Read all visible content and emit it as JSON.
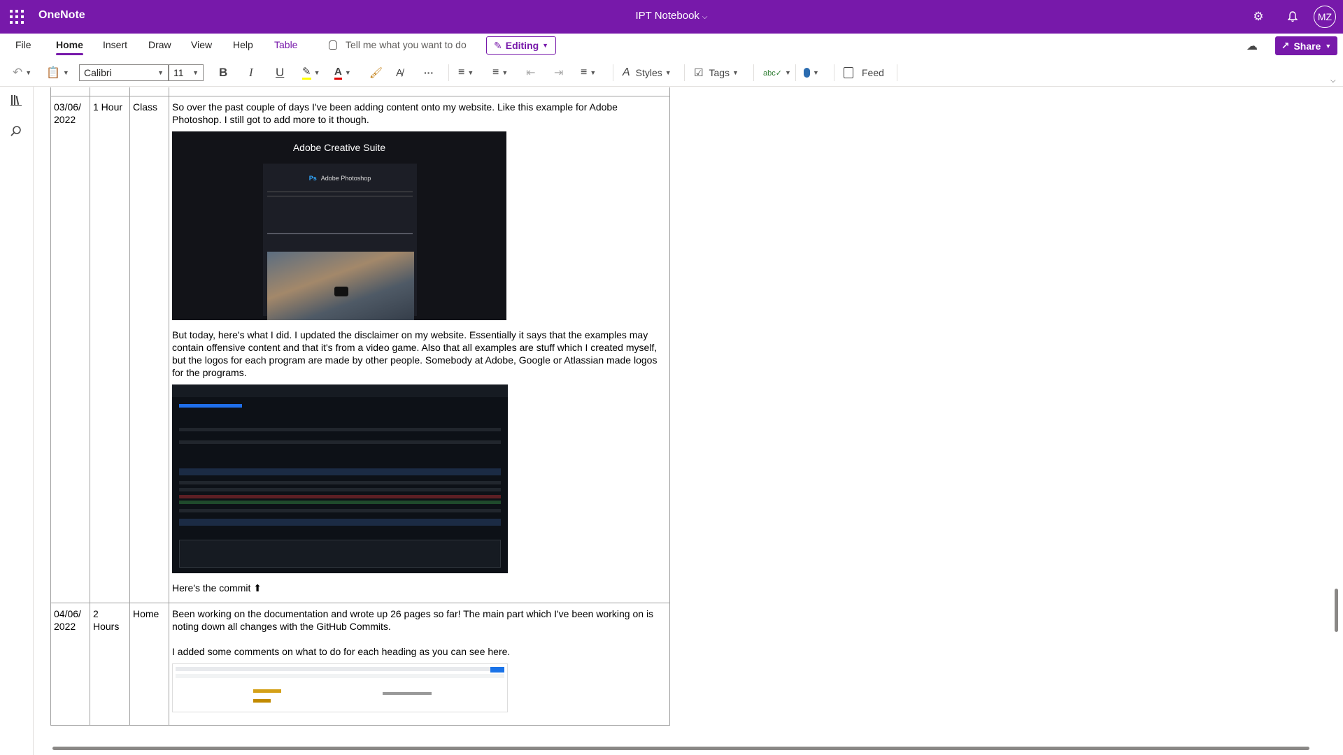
{
  "app": {
    "name": "OneNote",
    "notebook": "IPT Notebook",
    "user_initials": "MZ",
    "accent_color": "#7719aa"
  },
  "menu": {
    "tabs": [
      "File",
      "Home",
      "Insert",
      "Draw",
      "View",
      "Help",
      "Table"
    ],
    "active_tab": "Home",
    "tell_me_placeholder": "Tell me what you want to do",
    "mode_label": "Editing",
    "share_label": "Share"
  },
  "toolbar": {
    "font_name": "Calibri",
    "font_size": "11",
    "bold": "B",
    "italic": "I",
    "underline": "U",
    "more": "···",
    "styles_label": "Styles",
    "tags_label": "Tags",
    "feed_label": "Feed",
    "highlight_color": "#ffff00",
    "font_color": "#e00000"
  },
  "rows": [
    {
      "date": "03/06/ 2022",
      "duration": "1 Hour",
      "location": "Class",
      "text1": "So over the past couple of days I've been adding content onto my website. Like this example for Adobe Photoshop. I still got to add more to it though.",
      "image1": {
        "title": "Adobe Creative Suite",
        "badge": "Ps",
        "subtitle": "Adobe Photoshop"
      },
      "text2": "But today, here's what I did. I updated the disclaimer on my website. Essentially it says that the examples may contain offensive content and that it's from a video game. Also that all examples are stuff which I created myself, but the logos for each program are made by other people. Somebody at Adobe, Google or Atlassian made logos for the programs.",
      "text3": "Here's the commit ⬆"
    },
    {
      "date": "04/06/ 2022",
      "duration": "2 Hours",
      "location": "Home",
      "text1": "Been working on the documentation and wrote up 26 pages so far! The main part which I've been working on is noting down all changes with the GitHub Commits.",
      "text2": "I added some comments on what to do for each heading as you can see here."
    }
  ]
}
